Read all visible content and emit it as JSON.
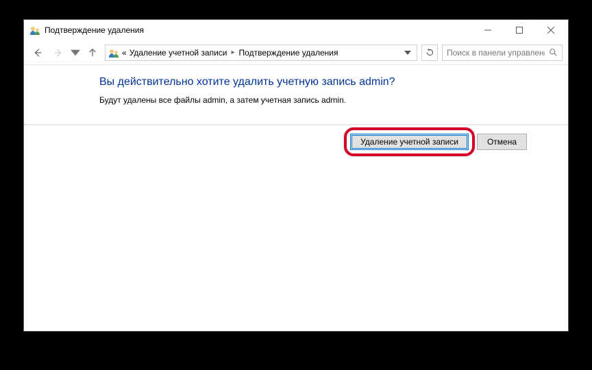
{
  "window": {
    "title": "Подтверждение удаления"
  },
  "nav": {
    "chevrons": "«",
    "segments": [
      "Удаление учетной записи",
      "Подтверждение удаления"
    ]
  },
  "search": {
    "placeholder": "Поиск в панели управления"
  },
  "main": {
    "heading": "Вы действительно хотите удалить учетную запись admin?",
    "description": "Будут удалены все файлы admin, а затем учетная запись admin."
  },
  "buttons": {
    "delete": "Удаление учетной записи",
    "cancel": "Отмена"
  }
}
